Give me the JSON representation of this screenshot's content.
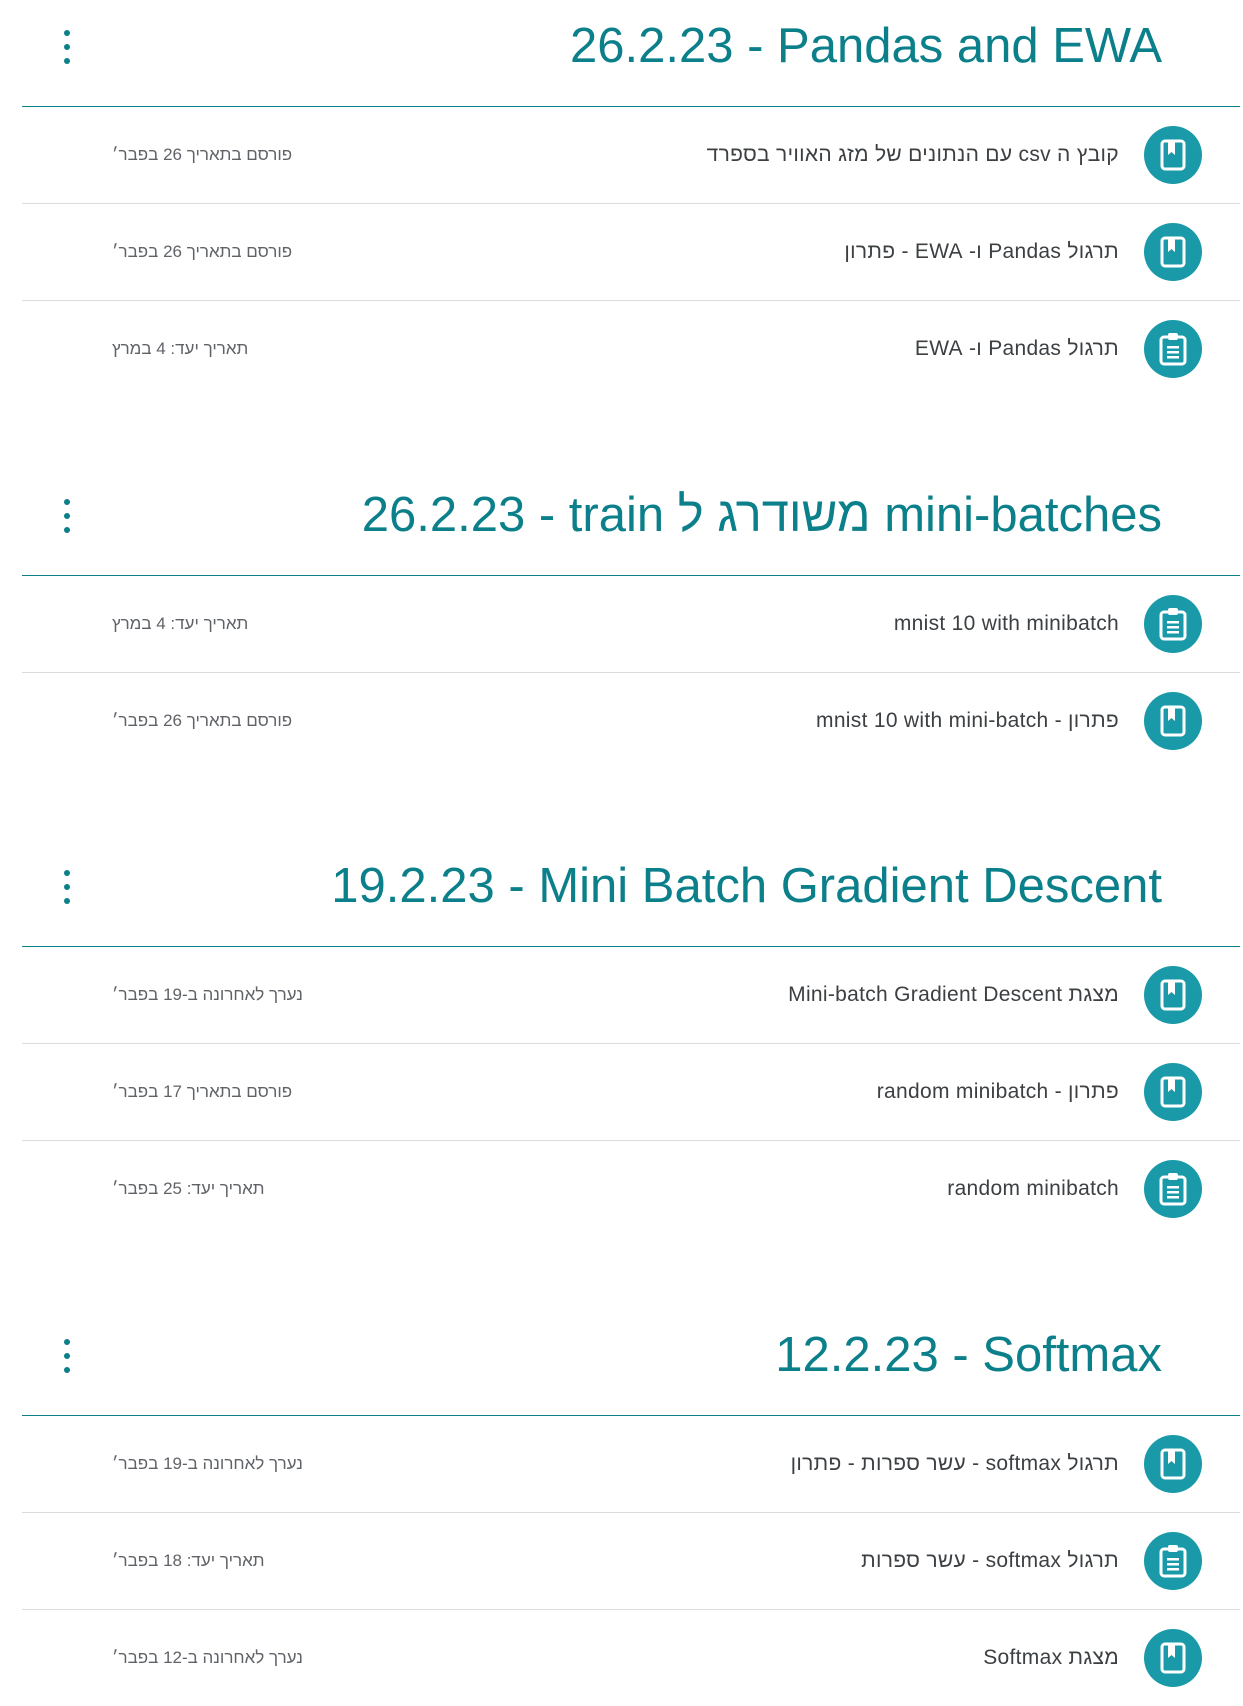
{
  "colors": {
    "accent": "#0b7f8a",
    "icon_bg": "#1a9aa8",
    "divider": "#dadce0"
  },
  "topics": [
    {
      "title": "26.2.23 - Pandas and EWA",
      "items": [
        {
          "title": "קובץ ה csv עם הנתונים של מזג האוויר בספרד",
          "meta": "פורסם בתאריך 26 בפבר׳",
          "icon": "material-icon"
        },
        {
          "title": "תרגול Pandas ו- EWA - פתרון",
          "meta": "פורסם בתאריך 26 בפבר׳",
          "icon": "material-icon"
        },
        {
          "title": "תרגול Pandas ו- EWA",
          "meta": "תאריך יעד: 4 במרץ",
          "icon": "assignment-icon"
        }
      ]
    },
    {
      "title": "26.2.23 - train משודרג ל mini-batches",
      "items": [
        {
          "title": "mnist 10 with minibatch",
          "meta": "תאריך יעד: 4 במרץ",
          "icon": "assignment-icon"
        },
        {
          "title": "פתרון - mnist 10 with mini-batch",
          "meta": "פורסם בתאריך 26 בפבר׳",
          "icon": "material-icon"
        }
      ]
    },
    {
      "title": "19.2.23 - Mini Batch Gradient Descent",
      "items": [
        {
          "title": "מצגת Mini-batch Gradient Descent",
          "meta": "נערך לאחרונה ב-19 בפבר׳",
          "icon": "material-icon"
        },
        {
          "title": "פתרון - random minibatch",
          "meta": "פורסם בתאריך 17 בפבר׳",
          "icon": "material-icon"
        },
        {
          "title": "random minibatch",
          "meta": "תאריך יעד: 25 בפבר׳",
          "icon": "assignment-icon"
        }
      ]
    },
    {
      "title": "12.2.23 - Softmax",
      "items": [
        {
          "title": "תרגול softmax - עשר ספרות - פתרון",
          "meta": "נערך לאחרונה ב-19 בפבר׳",
          "icon": "material-icon"
        },
        {
          "title": "תרגול softmax - עשר ספרות",
          "meta": "תאריך יעד: 18 בפבר׳",
          "icon": "assignment-icon"
        },
        {
          "title": "מצגת Softmax",
          "meta": "נערך לאחרונה ב-12 בפבר׳",
          "icon": "material-icon"
        }
      ]
    }
  ]
}
